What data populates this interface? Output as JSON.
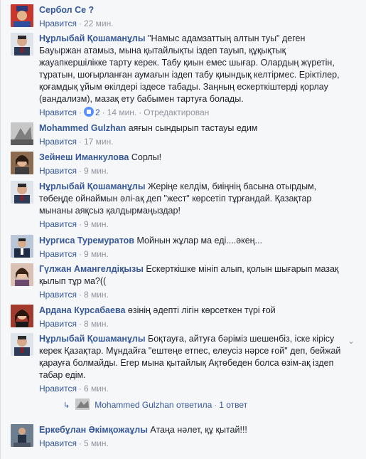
{
  "comments": [
    {
      "author": "Сербол Се ?",
      "text": "",
      "like": "Нравится",
      "time": "22 мин."
    },
    {
      "author": "Нұрлыбай Қошаманұлы",
      "text": "\"Намыс адамзаттың алтын туы\" деген Бауыржан атамыз, мына қытайлықты іздеп тауып, құқықтық жауапкершілікке тарту керек. Табу қиын емес шығар. Олардың жүретін, тұратын, шоғырланған аумағын іздеп табу қиындық келтірмес. Еріктілер, қоғамдық ұйым өкілдері іздесе табады. Заңның ескерткіштерді қорлау (вандализм), мазақ ету бабымен тартуға болады.",
      "like": "Нравится",
      "reactions": "2",
      "time": "14 мин.",
      "edited": "Отредактирован"
    },
    {
      "author": "Mohammed Gulzhan",
      "text": "аяғын сындырып тастауы едим",
      "like": "Нравится",
      "time": "17 мин."
    },
    {
      "author": "Зейнеш Иманкулова",
      "text": "Сорлы!",
      "like": "Нравится",
      "time": "9 мин."
    },
    {
      "author": "Нұрлыбай Қошаманұлы",
      "text": "Жеріңе келдім, биіңнің басына отырдым, төбеңде ойнаймын әлі-ақ деп \"жест\" көрсетіп тұрғандай. Қазақтар мынаны аяқсыз қалдырмаңыздар!",
      "like": "Нравится",
      "time": "9 мин."
    },
    {
      "author": "Нургиса Туремуратов",
      "text": "Мойнын жұлар ма еді....әкең...",
      "like": "Нравится",
      "time": "9 мин."
    },
    {
      "author": "Гүлжан Амангелдіқызы",
      "text": "Ескерткішке мініп алып, қолын шығарып мазақ қылып тұр ма?((",
      "like": "Нравится",
      "time": "8 мин."
    },
    {
      "author": "Ардана Курсабаева",
      "text": "өзінің әдепті лігін көрсеткен түрі ғой",
      "like": "Нравится",
      "time": "8 мин."
    },
    {
      "author": "Нұрлыбай Қошаманұлы",
      "text": "Боқтауға, айтуға бәріміз шешенбіз, іске кірісу керек Қазақтар. Мұндайға \"ештеңе етпес, елеусіз нәрсе ғой\" деп, бейжай қарауға болмайды. Егер мына қытайлық Ақтөбеден болса өзім-ақ іздеп табар едім.",
      "like": "Нравится",
      "time": "6 мин."
    },
    {
      "author": "Еркебұлан Әкімқожаұлы",
      "text": "Атаңа нәлет, құ қытай!!!",
      "like": "Нравится",
      "time": "5 мин."
    }
  ],
  "reply": {
    "author": "Mohammed Gulzhan",
    "action": "ответила",
    "count": "1 ответ"
  },
  "colors": {
    "link": "#365899",
    "meta": "#90949c",
    "text": "#1d2129",
    "background": "#f6f7f9"
  }
}
